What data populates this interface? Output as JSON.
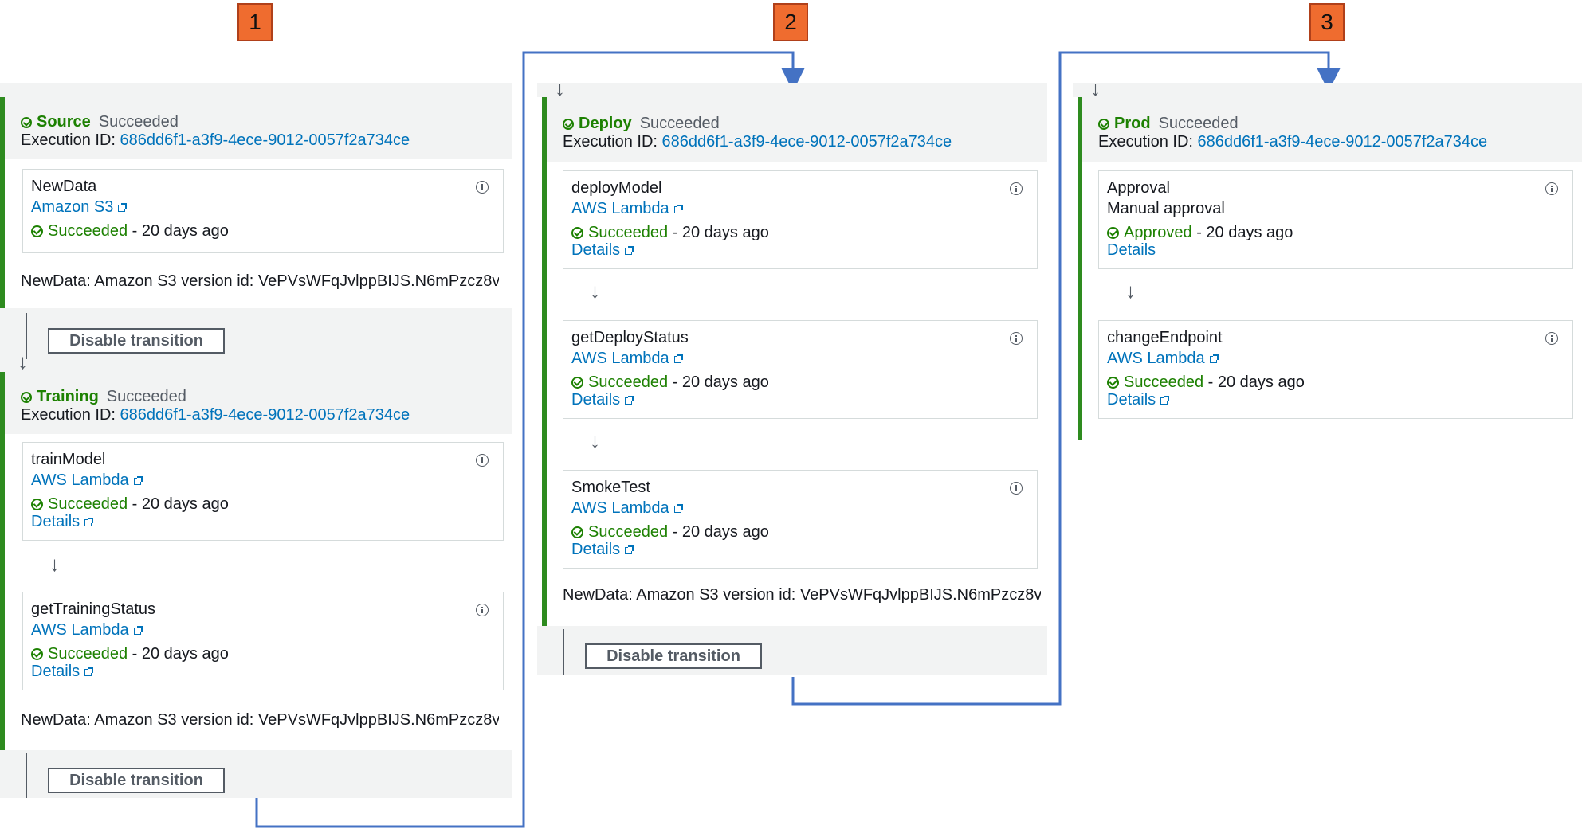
{
  "markers": [
    "1",
    "2",
    "3"
  ],
  "execution_label": "Execution ID:",
  "execution_id": "686dd6f1-a3f9-4ece-9012-0057f2a734ce",
  "status_succeeded": "Succeeded",
  "status_time": "- 20 days ago",
  "details_label": "Details",
  "artifact_text": "NewData: Amazon S3 version id: VePVsWFqJvlppBIJS.N6mPzcz8v",
  "disable_transition_label": "Disable transition",
  "stages": {
    "source": {
      "name": "Source",
      "status": "Succeeded",
      "actions": [
        {
          "name": "NewData",
          "provider": "Amazon S3",
          "status": "Succeeded"
        }
      ]
    },
    "training": {
      "name": "Training",
      "status": "Succeeded",
      "actions": [
        {
          "name": "trainModel",
          "provider": "AWS Lambda",
          "status": "Succeeded"
        },
        {
          "name": "getTrainingStatus",
          "provider": "AWS Lambda",
          "status": "Succeeded"
        }
      ]
    },
    "deploy": {
      "name": "Deploy",
      "status": "Succeeded",
      "actions": [
        {
          "name": "deployModel",
          "provider": "AWS Lambda",
          "status": "Succeeded"
        },
        {
          "name": "getDeployStatus",
          "provider": "AWS Lambda",
          "status": "Succeeded"
        },
        {
          "name": "SmokeTest",
          "provider": "AWS Lambda",
          "status": "Succeeded"
        }
      ]
    },
    "prod": {
      "name": "Prod",
      "status": "Succeeded",
      "actions": [
        {
          "name": "Approval",
          "provider": "Manual approval",
          "status": "Approved"
        },
        {
          "name": "changeEndpoint",
          "provider": "AWS Lambda",
          "status": "Succeeded"
        }
      ]
    }
  },
  "colors": {
    "stage_border": "#2e8b1f",
    "link": "#0073bb",
    "success": "#1d8102",
    "marker": "#ef6c2f",
    "connector": "#4472c4"
  }
}
